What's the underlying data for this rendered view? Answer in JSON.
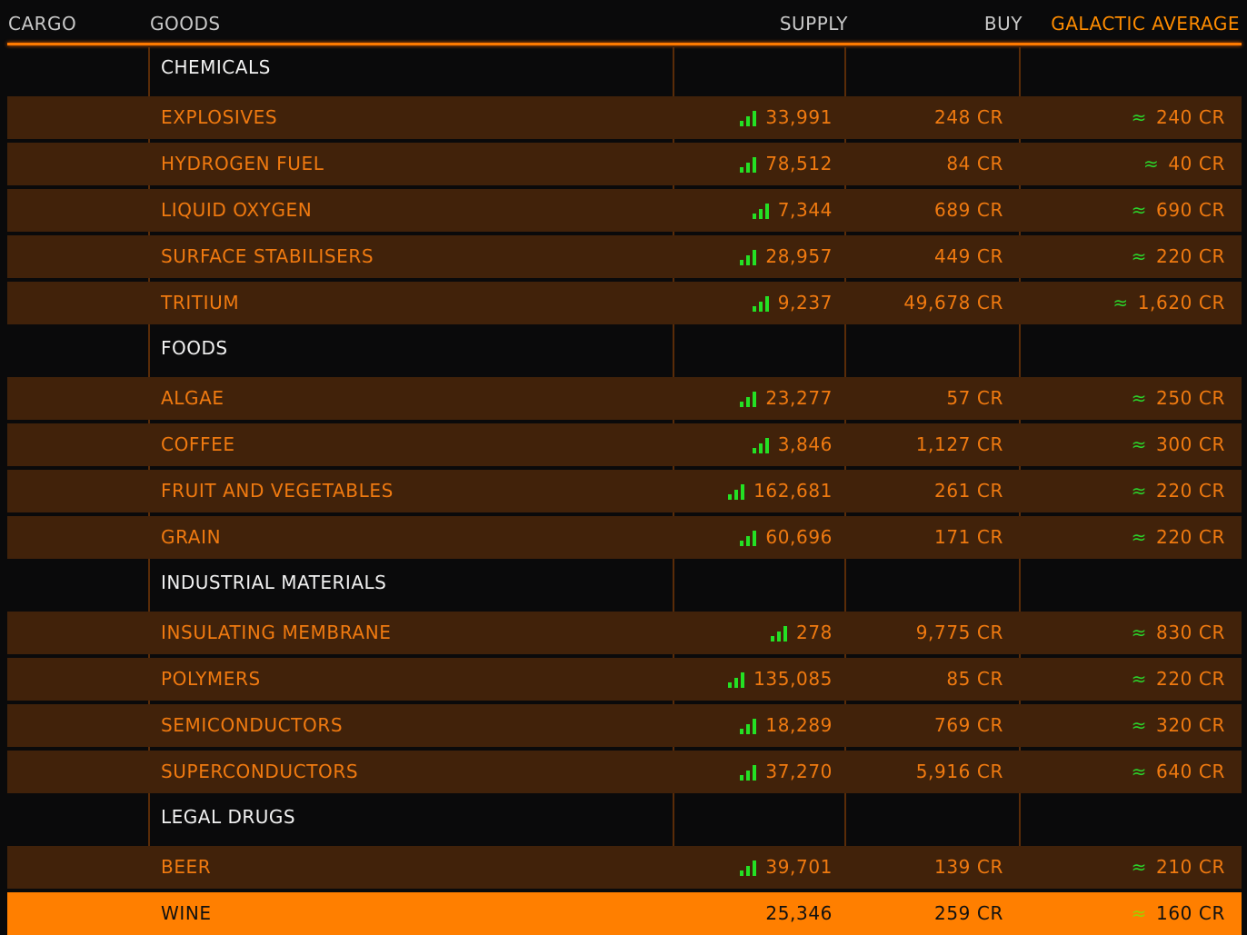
{
  "header": {
    "cargo": "CARGO",
    "goods": "GOODS",
    "supply": "SUPPLY",
    "buy": "BUY",
    "galactic_average": "GALACTIC AVERAGE"
  },
  "colors": {
    "accent": "#ff7f00",
    "row_bg": "#41220a",
    "row_text": "#f07a10",
    "supply_bars": "#24e024",
    "approx_symbol": "#2bd42b"
  },
  "market": [
    {
      "kind": "category",
      "label": "CHEMICALS"
    },
    {
      "kind": "item",
      "name": "EXPLOSIVES",
      "supply": "33,991",
      "buy": "248 CR",
      "approx": "≈",
      "avg": "240 CR",
      "supply_icon": "supply-bars-icon"
    },
    {
      "kind": "item",
      "name": "HYDROGEN FUEL",
      "supply": "78,512",
      "buy": "84 CR",
      "approx": "≈",
      "avg": "40 CR",
      "supply_icon": "supply-bars-icon"
    },
    {
      "kind": "item",
      "name": "LIQUID OXYGEN",
      "supply": "7,344",
      "buy": "689 CR",
      "approx": "≈",
      "avg": "690 CR",
      "supply_icon": "supply-bars-icon"
    },
    {
      "kind": "item",
      "name": "SURFACE STABILISERS",
      "supply": "28,957",
      "buy": "449 CR",
      "approx": "≈",
      "avg": "220 CR",
      "supply_icon": "supply-bars-icon"
    },
    {
      "kind": "item",
      "name": "TRITIUM",
      "supply": "9,237",
      "buy": "49,678 CR",
      "approx": "≈",
      "avg": "1,620 CR",
      "supply_icon": "supply-bars-icon"
    },
    {
      "kind": "category",
      "label": "FOODS"
    },
    {
      "kind": "item",
      "name": "ALGAE",
      "supply": "23,277",
      "buy": "57 CR",
      "approx": "≈",
      "avg": "250 CR",
      "supply_icon": "supply-bars-icon"
    },
    {
      "kind": "item",
      "name": "COFFEE",
      "supply": "3,846",
      "buy": "1,127 CR",
      "approx": "≈",
      "avg": "300 CR",
      "supply_icon": "supply-bars-icon"
    },
    {
      "kind": "item",
      "name": "FRUIT AND VEGETABLES",
      "supply": "162,681",
      "buy": "261 CR",
      "approx": "≈",
      "avg": "220 CR",
      "supply_icon": "supply-bars-icon"
    },
    {
      "kind": "item",
      "name": "GRAIN",
      "supply": "60,696",
      "buy": "171 CR",
      "approx": "≈",
      "avg": "220 CR",
      "supply_icon": "supply-bars-icon"
    },
    {
      "kind": "category",
      "label": "INDUSTRIAL MATERIALS"
    },
    {
      "kind": "item",
      "name": "INSULATING MEMBRANE",
      "supply": "278",
      "buy": "9,775 CR",
      "approx": "≈",
      "avg": "830 CR",
      "supply_icon": "supply-bars-icon"
    },
    {
      "kind": "item",
      "name": "POLYMERS",
      "supply": "135,085",
      "buy": "85 CR",
      "approx": "≈",
      "avg": "220 CR",
      "supply_icon": "supply-bars-icon"
    },
    {
      "kind": "item",
      "name": "SEMICONDUCTORS",
      "supply": "18,289",
      "buy": "769 CR",
      "approx": "≈",
      "avg": "320 CR",
      "supply_icon": "supply-bars-icon"
    },
    {
      "kind": "item",
      "name": "SUPERCONDUCTORS",
      "supply": "37,270",
      "buy": "5,916 CR",
      "approx": "≈",
      "avg": "640 CR",
      "supply_icon": "supply-bars-icon"
    },
    {
      "kind": "category",
      "label": "LEGAL DRUGS"
    },
    {
      "kind": "item",
      "name": "BEER",
      "supply": "39,701",
      "buy": "139 CR",
      "approx": "≈",
      "avg": "210 CR",
      "supply_icon": "supply-bars-icon"
    },
    {
      "kind": "item",
      "name": "WINE",
      "supply": "25,346",
      "buy": "259 CR",
      "approx": "≈",
      "avg": "160 CR",
      "selected": true
    }
  ]
}
